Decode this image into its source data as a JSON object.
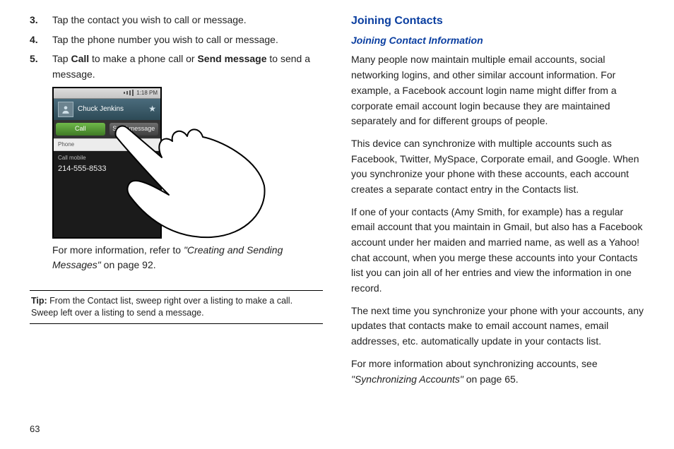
{
  "left": {
    "list": [
      {
        "num": "3.",
        "text": "Tap the contact you wish to call or message."
      },
      {
        "num": "4.",
        "text": "Tap the phone number you wish to call or message."
      },
      {
        "num": "5.",
        "pre": "Tap ",
        "b1": "Call",
        "mid": " to make a phone call or ",
        "b2": "Send message",
        "post": " to send a message."
      }
    ],
    "phone": {
      "time": "1:18 PM",
      "contact_name": "Chuck Jenkins",
      "call_btn": "Call",
      "msg_btn": "Send message",
      "section_label": "Phone",
      "entry_label": "Call mobile",
      "entry_number": "214-555-8533"
    },
    "ref_pre": "For more information, refer to ",
    "ref_title": "\"Creating and Sending Messages\"",
    "ref_post": "  on page 92.",
    "tip_label": "Tip: ",
    "tip_text": "From the Contact list, sweep right over a listing to make a call. Sweep left over a listing to send a message.",
    "page_number": "63"
  },
  "right": {
    "h2": "Joining Contacts",
    "h3": "Joining Contact Information",
    "p1": "Many people now maintain multiple email accounts, social networking logins, and other similar account information. For example, a Facebook account login name might differ from a corporate email account login because they are maintained separately and for different groups of people.",
    "p2": "This device can synchronize with multiple accounts such as Facebook, Twitter, MySpace, Corporate email, and Google. When you synchronize your phone with these accounts, each account creates a separate contact entry in the Contacts list.",
    "p3": "If one of your contacts (Amy Smith, for example) has a regular email account that you maintain in Gmail, but also has a Facebook account under her maiden and married name, as well as a Yahoo! chat account, when you merge these accounts into your Contacts list you can join all of her entries and view the information in one record.",
    "p4": "The next time you synchronize your phone with your accounts, any updates that contacts make to email account names, email addresses, etc. automatically update in your contacts list.",
    "p5_pre": "For more information about synchronizing accounts, see ",
    "p5_ref": "\"Synchronizing Accounts\"",
    "p5_post": " on page 65."
  }
}
